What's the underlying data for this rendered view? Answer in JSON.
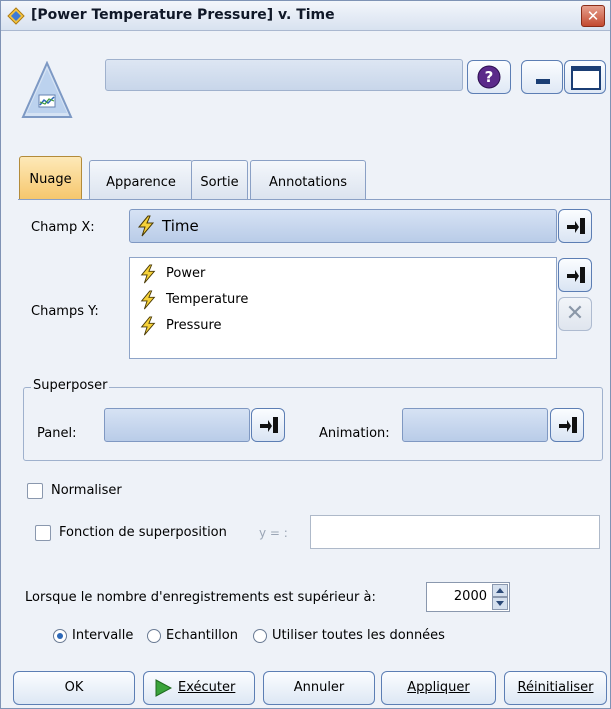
{
  "window": {
    "title": "[Power Temperature Pressure] v. Time",
    "close_glyph": "✕"
  },
  "header": {
    "help_glyph": "?",
    "node_name": ""
  },
  "tabs": [
    {
      "label": "Nuage"
    },
    {
      "label": "Apparence"
    },
    {
      "label": "Sortie"
    },
    {
      "label": "Annotations"
    }
  ],
  "fields": {
    "x_label": "Champ X:",
    "x_value": "Time",
    "y_label": "Champs Y:",
    "y_values": [
      "Power",
      "Temperature",
      "Pressure"
    ],
    "delete_glyph": "✕"
  },
  "overlay": {
    "legend": "Superposer",
    "panel_label": "Panel:",
    "panel_value": "",
    "animation_label": "Animation:",
    "animation_value": ""
  },
  "options": {
    "normalize_label": "Normaliser",
    "overlay_function_label": "Fonction de superposition",
    "y_equals": "y = :",
    "function_value": "",
    "records_label": "Lorsque le nombre d'enregistrements est supérieur à:",
    "records_value": "2000",
    "radio_interval": "Intervalle",
    "radio_sample": "Echantillon",
    "radio_all": "Utiliser toutes les données",
    "selected_radio": "Intervalle"
  },
  "footer": {
    "ok": "OK",
    "run": "Exécuter",
    "cancel": "Annuler",
    "apply": "Appliquer",
    "reset": "Réinitialiser"
  },
  "colors": {
    "active_tab": "#f6c66b",
    "accent": "#2c68b8"
  }
}
